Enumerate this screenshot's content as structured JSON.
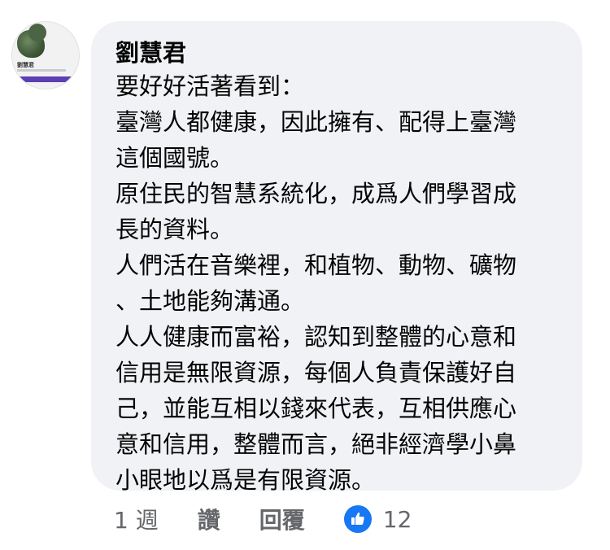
{
  "comment": {
    "author": "劉慧君",
    "lines": [
      "要好好活著看到：",
      "臺灣人都健康，因此擁有、配得上臺灣",
      "這個國號。",
      "原住民的智慧系統化，成爲人們學習成",
      "長的資料。",
      "人們活在音樂裡，和植物、動物、礦物",
      "、土地能夠溝通。",
      "人人健康而富裕，認知到整體的心意和",
      "信用是無限資源，每個人負責保護好自",
      "己，並能互相以錢來代表，互相供應心",
      "意和信用，整體而言，絕非經濟學小鼻",
      "小眼地以爲是有限資源。"
    ],
    "avatar_icon": "profile-photo-avatar",
    "avatar_text": "劉慧君"
  },
  "actions": {
    "time": "1 週",
    "like_label": "讚",
    "reply_label": "回覆",
    "reaction_icon": "thumbs-up-icon",
    "reaction_count": "12"
  },
  "colors": {
    "bubble_bg": "#f0f2f5",
    "text": "#050505",
    "secondary_text": "#65676b",
    "like_blue": "#1877f2"
  }
}
